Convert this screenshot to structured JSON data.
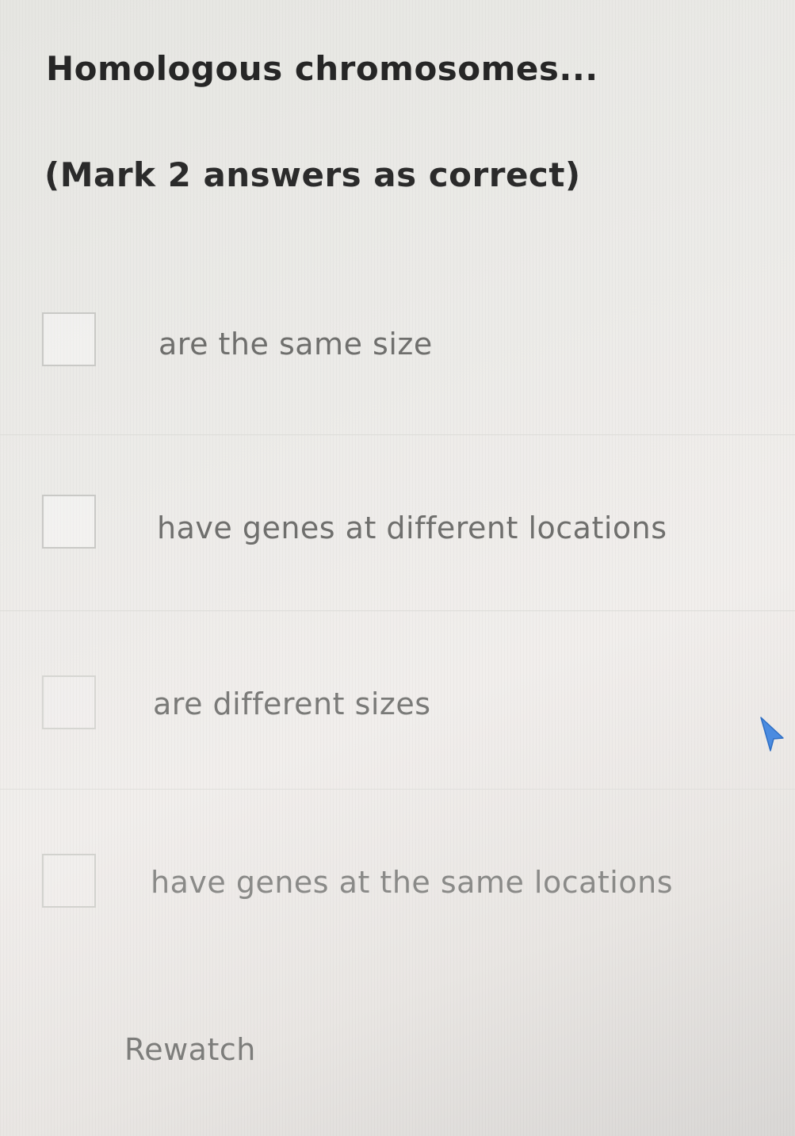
{
  "question": "Homologous chromosomes...",
  "instruction": "(Mark 2 answers as correct)",
  "options": [
    {
      "label": "are the same size"
    },
    {
      "label": "have genes at different locations"
    },
    {
      "label": "are different sizes"
    },
    {
      "label": "have genes at the same locations"
    }
  ],
  "rewatch_label": "Rewatch",
  "colors": {
    "text_dark": "#262626",
    "text_option": "#6f6f6d",
    "cursor": "#4a8be0"
  },
  "icons": {
    "cursor": "cursor-arrow-icon"
  }
}
